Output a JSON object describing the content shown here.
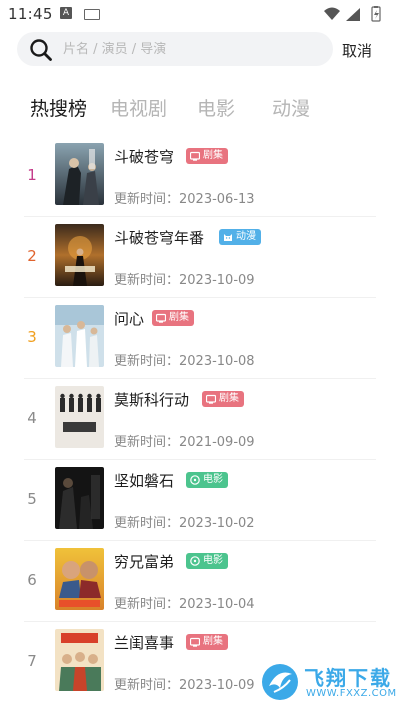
{
  "status_bar": {
    "time": "11:45",
    "a_icon_letter": "A"
  },
  "search": {
    "placeholder": "片名 / 演员 / 导演",
    "value": "",
    "cancel_label": "取消"
  },
  "tabs": [
    {
      "label": "热搜榜",
      "active": true
    },
    {
      "label": "电视剧",
      "active": false
    },
    {
      "label": "电影",
      "active": false
    },
    {
      "label": "动漫",
      "active": false
    }
  ],
  "colors": {
    "rank_1": "#c43c8a",
    "rank_2": "#e0632d",
    "rank_3": "#f0a020",
    "rank_other": "#8a8a8a",
    "badge_drama": "#e8737f",
    "badge_anime": "#52b0e8",
    "badge_movie": "#4cc48e"
  },
  "items": [
    {
      "rank": "1",
      "title": "斗破苍穹",
      "badge": "剧集",
      "badge_icon": "tv-icon",
      "update": "更新时间：2023-06-13"
    },
    {
      "rank": "2",
      "title": "斗破苍穹年番",
      "badge": "动漫",
      "badge_icon": "cat-icon",
      "update": "更新时间：2023-10-09"
    },
    {
      "rank": "3",
      "title": "问心",
      "badge": "剧集",
      "badge_icon": "tv-icon",
      "update": "更新时间：2023-10-08"
    },
    {
      "rank": "4",
      "title": "莫斯科行动",
      "badge": "剧集",
      "badge_icon": "tv-icon",
      "update": "更新时间：2021-09-09"
    },
    {
      "rank": "5",
      "title": "坚如磐石",
      "badge": "电影",
      "badge_icon": "film-reel-icon",
      "update": "更新时间：2023-10-02"
    },
    {
      "rank": "6",
      "title": "穷兄富弟",
      "badge": "电影",
      "badge_icon": "film-reel-icon",
      "update": "更新时间：2023-10-04"
    },
    {
      "rank": "7",
      "title": "兰闺喜事",
      "badge": "剧集",
      "badge_icon": "tv-icon",
      "update": "更新时间：2023-10-09"
    }
  ],
  "watermark": {
    "text": "飞翔下载",
    "url": "WWW.FXXZ.COM"
  }
}
